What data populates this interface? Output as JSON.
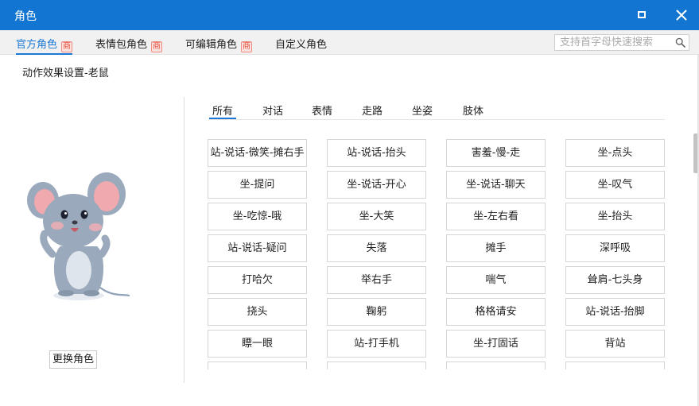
{
  "window": {
    "title": "角色"
  },
  "top_tabs": [
    {
      "label": "官方角色",
      "active": true,
      "badge": "商"
    },
    {
      "label": "表情包角色",
      "active": false,
      "badge": "商"
    },
    {
      "label": "可编辑角色",
      "active": false,
      "badge": "商"
    },
    {
      "label": "自定义角色",
      "active": false,
      "badge": ""
    }
  ],
  "search": {
    "placeholder": "支持首字母快速搜索",
    "value": ""
  },
  "section_label": "动作效果设置-老鼠",
  "change_button": "更换角色",
  "sub_tabs": [
    {
      "label": "所有",
      "active": true
    },
    {
      "label": "对话",
      "active": false
    },
    {
      "label": "表情",
      "active": false
    },
    {
      "label": "走路",
      "active": false
    },
    {
      "label": "坐姿",
      "active": false
    },
    {
      "label": "肢体",
      "active": false
    }
  ],
  "actions": [
    [
      "站-说话-微笑-摊右手",
      "站-说话-抬头",
      "害羞-慢-走",
      "坐-点头"
    ],
    [
      "坐-提问",
      "坐-说话-开心",
      "坐-说话-聊天",
      "坐-叹气"
    ],
    [
      "坐-吃惊-哦",
      "坐-大笑",
      "坐-左右看",
      "坐-抬头"
    ],
    [
      "站-说话-疑问",
      "失落",
      "摊手",
      "深呼吸"
    ],
    [
      "打哈欠",
      "举右手",
      "喘气",
      "耸肩-七头身"
    ],
    [
      "挠头",
      "鞠躬",
      "格格请安",
      "站-说话-抬脚"
    ],
    [
      "瞟一眼",
      "站-打手机",
      "坐-打固话",
      "背站"
    ],
    [
      "",
      "",
      "",
      ""
    ]
  ],
  "colors": {
    "titlebar": "#1275d2",
    "accent": "#1b78d5",
    "badge": "#e44d3e"
  }
}
